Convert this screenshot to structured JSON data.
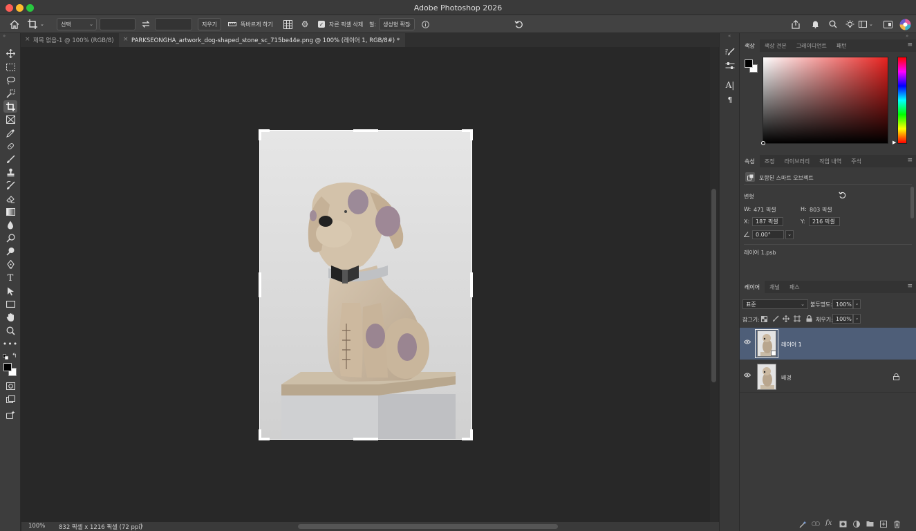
{
  "app": {
    "title": "Adobe Photoshop 2026"
  },
  "options_bar": {
    "crop_mode": "선택",
    "clear_label": "지우기",
    "straighten_label": "똑바르게 하기",
    "delete_cropped_label": "자른 픽셀 삭제",
    "delete_cropped_checked": true,
    "fill_label": "칠:",
    "fill_value": "생성형 확장"
  },
  "tabs": [
    {
      "label": "제목 없음-1 @ 100% (RGB/8)",
      "active": false
    },
    {
      "label": "PARKSEONGHA_artwork_dog-shaped_stone_sc_715be44e.png @ 100% (레이어 1, RGB/8#) *",
      "active": true
    }
  ],
  "status": {
    "zoom": "100%",
    "doc_size": "832 픽셀 x 1216 픽셀 (72 ppi)",
    "arrow": "〉"
  },
  "color_panel": {
    "tabs": [
      "색상",
      "색상 견본",
      "그레이디언트",
      "패턴"
    ],
    "foreground": "#000000",
    "background": "#ffffff",
    "hue_color": "#e8221f"
  },
  "properties_panel": {
    "tabs": [
      "속성",
      "조정",
      "라이브러리",
      "작업 내역",
      "주석"
    ],
    "object_type": "포함된 스마트 오브젝트",
    "transform_label": "변형",
    "w_label": "W:",
    "w_value": "471 픽셀",
    "h_label": "H:",
    "h_value": "803 픽셀",
    "x_label": "X:",
    "x_value": "187 픽셀",
    "y_label": "Y:",
    "y_value": "216 픽셀",
    "angle_value": "0.00°",
    "linked_file": "레이어 1.psb"
  },
  "layers_panel": {
    "tabs": [
      "레이어",
      "채널",
      "패스"
    ],
    "blend_mode": "표준",
    "opacity_label": "불투명도:",
    "opacity_value": "100%",
    "lock_label": "잠그기:",
    "fill_label": "채우기:",
    "fill_value": "100%",
    "layers": [
      {
        "name": "레이어 1",
        "selected": true,
        "locked": false
      },
      {
        "name": "배경",
        "selected": false,
        "locked": true
      }
    ]
  }
}
